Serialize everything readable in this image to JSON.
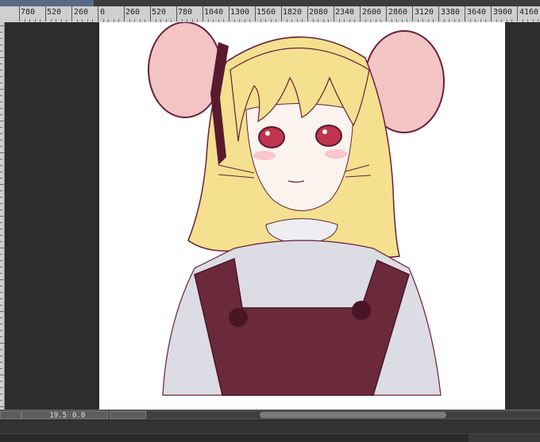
{
  "ruler": {
    "h_labels": [
      "780",
      "520",
      "260",
      "0",
      "260",
      "520",
      "780",
      "1040",
      "1300",
      "1560",
      "1820",
      "2080",
      "2340",
      "2600",
      "2860",
      "3120",
      "3380",
      "3640",
      "3900",
      "4160"
    ]
  },
  "status": {
    "zoom": "19.5",
    "rotation": "0.0"
  },
  "canvas": {
    "subject": "anime-girl-with-mouse-ears-illustration"
  },
  "colors": {
    "ruler_bg": "#cfcfcf",
    "workspace_bg": "#2d2d2d",
    "canvas_bg": "#ffffff",
    "hair": "#f5e08f",
    "outline": "#6a1f3a",
    "ear_inner": "#f2c4c4",
    "dress": "#6a2a3b",
    "blouse": "#dcdce4"
  }
}
